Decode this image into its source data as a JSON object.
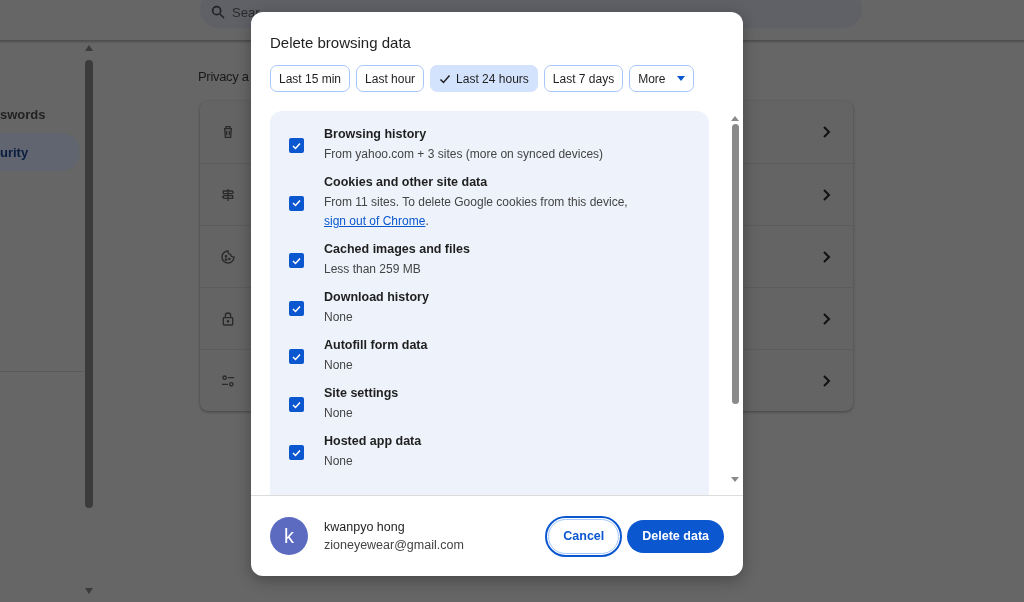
{
  "search": {
    "placeholder": "Sear"
  },
  "sidebar": {
    "items": [
      {
        "label": "swords",
        "selected": false
      },
      {
        "label": "urity",
        "selected": true
      }
    ]
  },
  "section_title": "Privacy a",
  "settings_rows": [
    {
      "kind": "trash"
    },
    {
      "kind": "signpost"
    },
    {
      "kind": "cookie"
    },
    {
      "kind": "lock"
    },
    {
      "kind": "sliders"
    }
  ],
  "dialog": {
    "title": "Delete browsing data",
    "chips": [
      {
        "label": "Last 15 min",
        "selected": false,
        "kind": "option"
      },
      {
        "label": "Last hour",
        "selected": false,
        "kind": "option"
      },
      {
        "label": "Last 24 hours",
        "selected": true,
        "kind": "option"
      },
      {
        "label": "Last 7 days",
        "selected": false,
        "kind": "option"
      },
      {
        "label": "More",
        "selected": false,
        "kind": "dropdown"
      }
    ],
    "items": [
      {
        "title": "Browsing history",
        "detail": "From yahoo.com + 3 sites (more on synced devices)",
        "checked": true
      },
      {
        "title": "Cookies and other site data",
        "detail": "From 11 sites. To delete Google cookies from this device,",
        "link": "sign out of Chrome",
        "detail_end": ".",
        "checked": true
      },
      {
        "title": "Cached images and files",
        "detail": "Less than 259 MB",
        "checked": true
      },
      {
        "title": "Download history",
        "detail": "None",
        "checked": true
      },
      {
        "title": "Autofill form data",
        "detail": "None",
        "checked": true
      },
      {
        "title": "Site settings",
        "detail": "None",
        "checked": true
      },
      {
        "title": "Hosted app data",
        "detail": "None",
        "checked": true
      }
    ],
    "account": {
      "initial": "k",
      "name": "kwanpyo hong",
      "email": "zioneyewear@gmail.com"
    },
    "buttons": {
      "cancel": "Cancel",
      "confirm": "Delete data"
    }
  }
}
